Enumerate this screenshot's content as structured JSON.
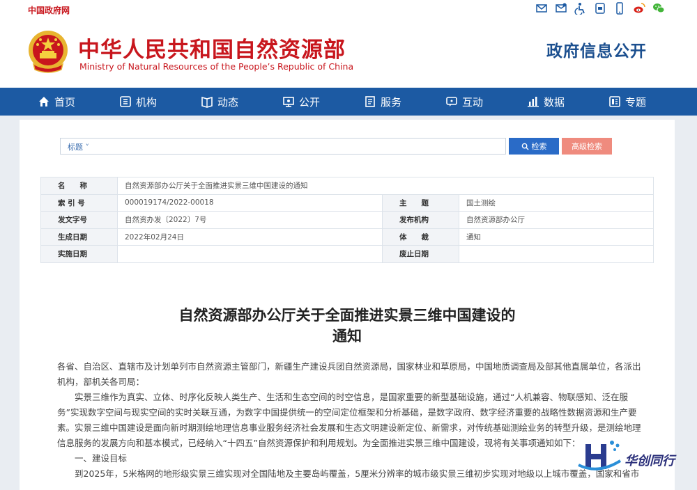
{
  "topbar": {
    "gov_link": "中国政府网",
    "icons": [
      "mail-icon",
      "feedback-icon",
      "accessibility-icon",
      "app-icon",
      "mobile-icon",
      "weibo-icon",
      "wechat-icon"
    ]
  },
  "header": {
    "title_cn": "中华人民共和国自然资源部",
    "title_en": "Ministry of Natural Resources of the People’s Republic of China",
    "info_open": "政府信息公开"
  },
  "nav": {
    "items": [
      {
        "label": "首页",
        "icon": "home-icon"
      },
      {
        "label": "机构",
        "icon": "org-icon"
      },
      {
        "label": "动态",
        "icon": "news-icon"
      },
      {
        "label": "公开",
        "icon": "disclosure-icon"
      },
      {
        "label": "服务",
        "icon": "service-icon"
      },
      {
        "label": "互动",
        "icon": "interact-icon"
      },
      {
        "label": "数据",
        "icon": "data-icon"
      },
      {
        "label": "专题",
        "icon": "topic-icon"
      }
    ]
  },
  "search": {
    "scope": "标题 ˅",
    "button": "检索",
    "advanced": "高级检索"
  },
  "meta": {
    "name_label": "名　　称",
    "name_value": "自然资源部办公厅关于全面推进实景三维中国建设的通知",
    "index_label": "索 引 号",
    "index_value": "000019174/2022-00018",
    "subject_label": "主　　题",
    "subject_value": "国土测绘",
    "docno_label": "发文字号",
    "docno_value": "自然资办发〔2022〕7号",
    "issuer_label": "发布机构",
    "issuer_value": "自然资源部办公厅",
    "date_label": "生成日期",
    "date_value": "2022年02月24日",
    "type_label": "体　　裁",
    "type_value": "通知",
    "effective_label": "实施日期",
    "effective_value": "",
    "expire_label": "废止日期",
    "expire_value": ""
  },
  "doc": {
    "title_line1": "自然资源部办公厅关于全面推进实景三维中国建设的",
    "title_line2": "通知",
    "salutation": "各省、自治区、直辖市及计划单列市自然资源主管部门，新疆生产建设兵团自然资源局，国家林业和草原局，中国地质调查局及部其他直属单位，各派出机构，部机关各司局：",
    "para1": "实景三维作为真实、立体、时序化反映人类生产、生活和生态空间的时空信息，是国家重要的新型基础设施，通过“人机兼容、物联感知、泛在服务”实现数字空间与现实空间的实时关联互通，为数字中国提供统一的空间定位框架和分析基础，是数字政府、数字经济重要的战略性数据资源和生产要素。实景三维中国建设是面向新时期测绘地理信息事业服务经济社会发展和生态文明建设新定位、新需求，对传统基础测绘业务的转型升级，是测绘地理信息服务的发展方向和基本模式，已经纳入“十四五”自然资源保护和利用规划。为全面推进实景三维中国建设，现将有关事项通知如下：",
    "section1": "一、建设目标",
    "para2": "到2025年，5米格网的地形级实景三维实现对全国陆地及主要岛屿覆盖，5厘米分辨率的城市级实景三维初步实现对地级以上城市覆盖，国家和省市"
  },
  "watermark": {
    "text": "华创同行"
  }
}
